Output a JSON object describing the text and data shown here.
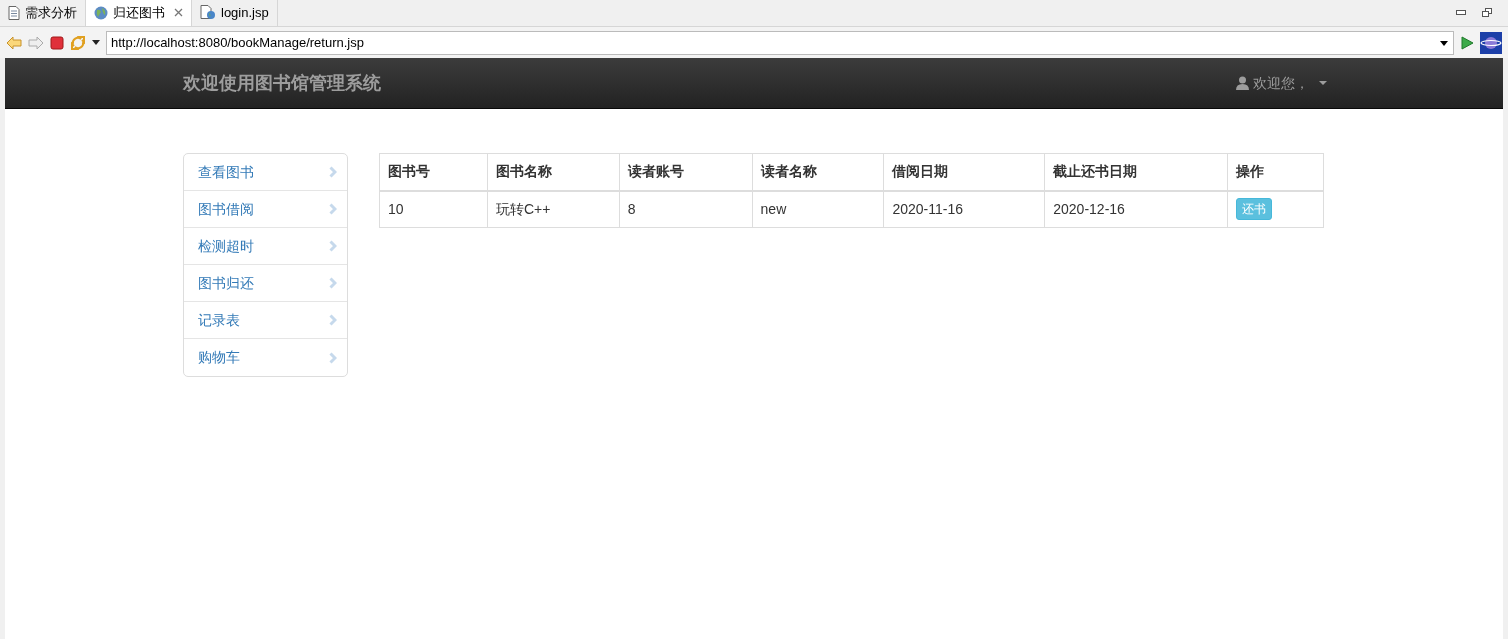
{
  "editor_tabs": [
    {
      "label": "需求分析",
      "kind": "document",
      "selected": false,
      "closable": false
    },
    {
      "label": "归还图书",
      "kind": "globe",
      "selected": true,
      "closable": true
    },
    {
      "label": "login.jsp",
      "kind": "jsp",
      "selected": false,
      "closable": false
    }
  ],
  "browser_toolbar": {
    "url": "http://localhost:8080/bookManage/return.jsp"
  },
  "navbar": {
    "brand": "欢迎使用图书馆管理系统",
    "user_menu": "欢迎您，"
  },
  "sidebar": {
    "items": [
      {
        "label": "查看图书"
      },
      {
        "label": "图书借阅"
      },
      {
        "label": "检测超时"
      },
      {
        "label": "图书归还"
      },
      {
        "label": "记录表"
      },
      {
        "label": "购物车"
      }
    ]
  },
  "table": {
    "columns": [
      "图书号",
      "图书名称",
      "读者账号",
      "读者名称",
      "借阅日期",
      "截止还书日期",
      "操作"
    ],
    "rows": [
      {
        "cells": [
          "10",
          "玩转C++",
          "8",
          "new",
          "2020-11-16",
          "2020-12-16"
        ],
        "action": "还书"
      }
    ]
  }
}
